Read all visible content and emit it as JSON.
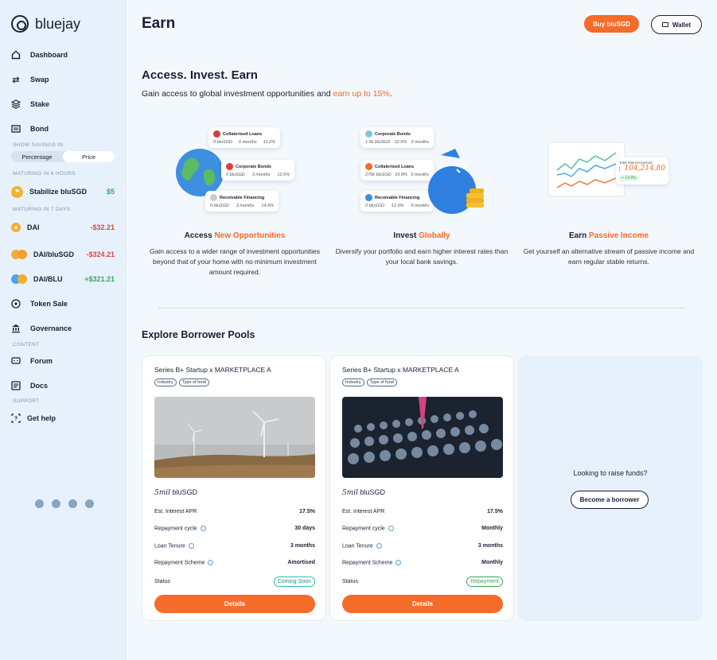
{
  "brand": {
    "name": "bluejay"
  },
  "sidebar": {
    "nav": [
      {
        "label": "Dashboard",
        "icon": "home-icon"
      },
      {
        "label": "Swap",
        "icon": "swap-icon"
      },
      {
        "label": "Stake",
        "icon": "layers-icon"
      },
      {
        "label": "Bond",
        "icon": "ticket-icon"
      }
    ],
    "show_savings_label": "SHOW SAVINGS IN",
    "toggle": {
      "left": "Percentage",
      "right": "Price",
      "active": "Price"
    },
    "maturing_6h_label": "MATURING IN 6 HOURS",
    "maturing_6h": [
      {
        "name": "Stabilize bluSGD",
        "value": "$5"
      }
    ],
    "maturing_7d_label": "MATURING IN 7 DAYS",
    "maturing_7d": [
      {
        "name": "DAI",
        "value": "-$32.21"
      },
      {
        "name": "DAI/bluSGD",
        "value": "-$324.21"
      },
      {
        "name": "DAI/BLU",
        "value": "+$321.21"
      }
    ],
    "nav2": [
      {
        "label": "Token Sale",
        "icon": "token-icon"
      },
      {
        "label": "Governance",
        "icon": "bank-icon"
      }
    ],
    "content_label": "CONTENT",
    "content": [
      {
        "label": "Forum",
        "icon": "chat-icon"
      },
      {
        "label": "Docs",
        "icon": "docs-icon"
      }
    ],
    "support_label": "SUPPORT",
    "support": [
      {
        "label": "Get help",
        "icon": "help-icon"
      }
    ]
  },
  "header": {
    "title": "Earn",
    "buy_label": "Buy bluSGD",
    "wallet_label": "Wallet"
  },
  "hero": {
    "title": "Access. Invest. Earn",
    "subtitle_prefix": "Gain access to global investment opportunities and ",
    "subtitle_accent": "earn up to 15%",
    "subtitle_suffix": "."
  },
  "features": [
    {
      "title_prefix": "Access ",
      "title_accent": "New Opportunities",
      "body": "Gain access to a wider range of investment opportunities beyond that of your home with no minimum investment amount required."
    },
    {
      "title_prefix": "Invest ",
      "title_accent": "Globally",
      "body": "Diversify your portfolio and earn higher interest rates than your local bank savings."
    },
    {
      "title_prefix": "Earn ",
      "title_accent": "Passive Income",
      "body": "Get yourself an alternative stream of passive income and earn regular stable returns."
    }
  ],
  "illus_1": {
    "cards": [
      {
        "title": "Collaterised Loans",
        "a": "0 bluSGD",
        "b": "6 months",
        "c": "11.2%"
      },
      {
        "title": "Corporate Bonds",
        "a": "0 bluSGD",
        "b": "3 months",
        "c": "12.5%"
      },
      {
        "title": "Receivable Financing",
        "a": "0 bluSGD",
        "b": "3 months",
        "c": "14.9%"
      }
    ]
  },
  "illus_2": {
    "cards": [
      {
        "title": "Corporate Bonds",
        "a": "1.5k bluSGD",
        "b": "12.5%",
        "c": "3 months"
      },
      {
        "title": "Collaterised Loans",
        "a": "270k bluSGD",
        "b": "15.8%",
        "c": "6 months"
      },
      {
        "title": "Receivable Financing",
        "a": "0 bluSGD",
        "b": "12.9%",
        "c": "9 months"
      }
    ]
  },
  "illus_3": {
    "label": "Total Interest Earned",
    "value": "104,214.80",
    "change": "+ 14.8%"
  },
  "explore_title": "Explore Borrower Pools",
  "pools": [
    {
      "title": "Series B+ Startup x MARKETPLACE A",
      "tags": [
        "Industry",
        "Type of fund"
      ],
      "amount_num": "5mil",
      "amount_unit": " bluSGD",
      "rows": [
        {
          "label": "Est. Interest APR",
          "value": "17.5%"
        },
        {
          "label": "Repayment cycle",
          "value": "30 days"
        },
        {
          "label": "Loan Tenure",
          "value": "3 months"
        },
        {
          "label": "Repayment Scheme",
          "value": "Amortised"
        }
      ],
      "status_label": "Status",
      "status": "Coming Soon",
      "details_label": "Details"
    },
    {
      "title": "Series B+ Startup x MARKETPLACE A",
      "tags": [
        "Industry",
        "Type of fund"
      ],
      "amount_num": "5mil",
      "amount_unit": " bluSGD",
      "rows": [
        {
          "label": "Est. Interest APR",
          "value": "17.5%"
        },
        {
          "label": "Repayment cycle",
          "value": "Monthly"
        },
        {
          "label": "Loan Tenure",
          "value": "3 months"
        },
        {
          "label": "Repayment Scheme",
          "value": "Monthly"
        }
      ],
      "status_label": "Status",
      "status": "Repayment",
      "details_label": "Details"
    }
  ],
  "raise": {
    "text": "Looking to raise funds?",
    "button": "Become a borrower"
  },
  "colors": {
    "accent": "#f56b2a",
    "sidebar_bg": "#e7f1fb",
    "negative": "#e0453c",
    "positive": "#3ba55c"
  }
}
